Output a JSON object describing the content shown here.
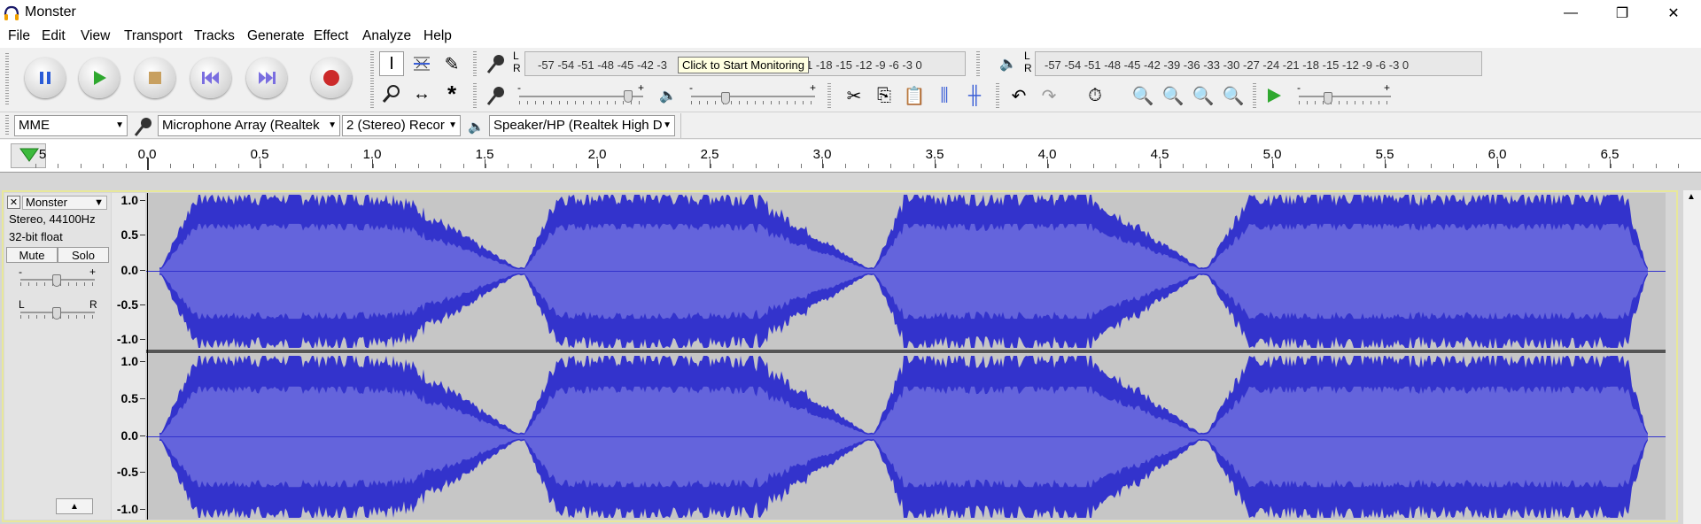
{
  "window": {
    "title": "Monster",
    "minimize": "—",
    "restore": "❐",
    "close": "✕"
  },
  "menu": [
    "File",
    "Edit",
    "View",
    "Transport",
    "Tracks",
    "Generate",
    "Effect",
    "Analyze",
    "Help"
  ],
  "transport": {
    "buttons": [
      "pause",
      "play",
      "stop",
      "skip-start",
      "skip-end",
      "record"
    ]
  },
  "tools": [
    "selection",
    "envelope",
    "draw",
    "zoom",
    "time-shift",
    "multi"
  ],
  "record_meter": {
    "lr": "L R",
    "scale": "-57 -54 -51 -48 -45 -42 -3",
    "scale_after": "1 -18 -15 -12  -9  -6  -3  0",
    "tooltip": "Click to Start Monitoring"
  },
  "play_meter": {
    "lr": "L R",
    "scale": "-57 -54 -51 -48 -45 -42 -39 -36 -33 -30 -27 -24 -21 -18 -15 -12  -9  -6  -3  0"
  },
  "mixer": {
    "minus": "-",
    "plus": "+",
    "rec_level": 0.88,
    "play_level": 0.28
  },
  "edit_toolbar": [
    "cut",
    "copy",
    "paste",
    "trim",
    "silence",
    "undo",
    "redo",
    "sync-lock",
    "zoom-in",
    "zoom-out",
    "fit-selection",
    "fit-project",
    "play-at-speed"
  ],
  "play_speed": {
    "minus": "-",
    "plus": "+"
  },
  "device": {
    "host": "MME",
    "input": "Microphone Array (Realtek",
    "channels": "2 (Stereo) Recor",
    "output": "Speaker/HP (Realtek High D"
  },
  "ruler": {
    "labels": [
      "5",
      "0.0",
      "0.5",
      "1.0",
      "1.5",
      "2.0",
      "2.5",
      "3.0",
      "3.5",
      "4.0",
      "4.5",
      "5.0",
      "5.5",
      "6.0",
      "6.5"
    ]
  },
  "track": {
    "name": "Monster",
    "info1": "Stereo, 44100Hz",
    "info2": "32-bit float",
    "mute": "Mute",
    "solo": "Solo",
    "gain": {
      "minus": "-",
      "plus": "+"
    },
    "pan": {
      "left": "L",
      "right": "R"
    },
    "scale": [
      "1.0",
      "0.5-",
      "0.0-",
      "-0.5-",
      "-1.0"
    ],
    "color": "#3232c8"
  },
  "colors": {
    "wave": "#3333cc",
    "wave_rms": "#6464dc",
    "selected_border": "#ffff6c",
    "bg": "#c6c6c6"
  }
}
